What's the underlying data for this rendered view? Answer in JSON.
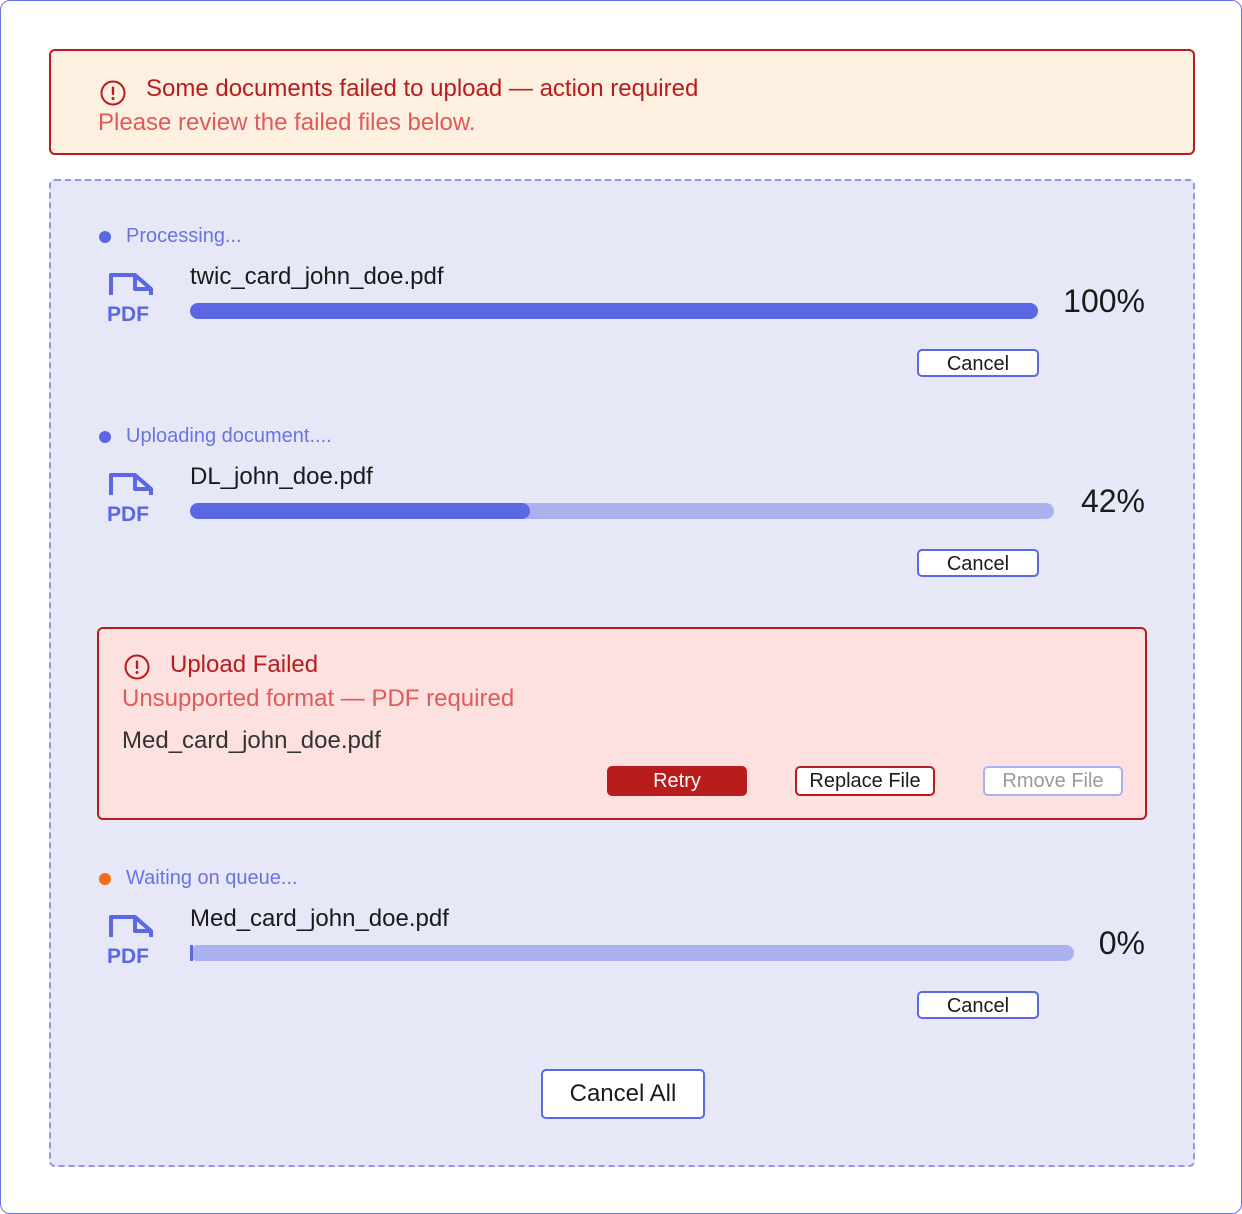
{
  "alert": {
    "title": "Some documents failed to upload — action required",
    "subtitle": "Please review the failed files below."
  },
  "uploads": [
    {
      "status": "Processing...",
      "status_color": "#5b67e3",
      "icon_label": "PDF",
      "filename": "twic_card_john_doe.pdf",
      "progress": 1.0,
      "percent_label": "100%",
      "cancel_label": "Cancel"
    },
    {
      "status": "Uploading document....",
      "status_color": "#5b67e3",
      "icon_label": "PDF",
      "filename": "DL_john_doe.pdf",
      "progress": 0.42,
      "percent_label": "42%",
      "cancel_label": "Cancel"
    },
    {
      "status": "Waiting on queue...",
      "status_color": "#f26a1b",
      "icon_label": "PDF",
      "filename": "Med_card_john_doe.pdf",
      "progress": 0.0,
      "percent_label": "0%",
      "cancel_label": "Cancel"
    }
  ],
  "failed": {
    "title": "Upload Failed",
    "reason": "Unsupported format — PDF required",
    "filename": "Med_card_john_doe.pdf",
    "retry_label": "Retry",
    "replace_label": "Replace File",
    "remove_label": "Rmove File"
  },
  "cancel_all_label": "Cancel All",
  "colors": {
    "accent": "#5b67e3",
    "error": "#b91c1c",
    "warning_bg": "#fdf0e1",
    "error_bg": "#fde1e1",
    "dropzone_bg": "#e6e8f7"
  }
}
